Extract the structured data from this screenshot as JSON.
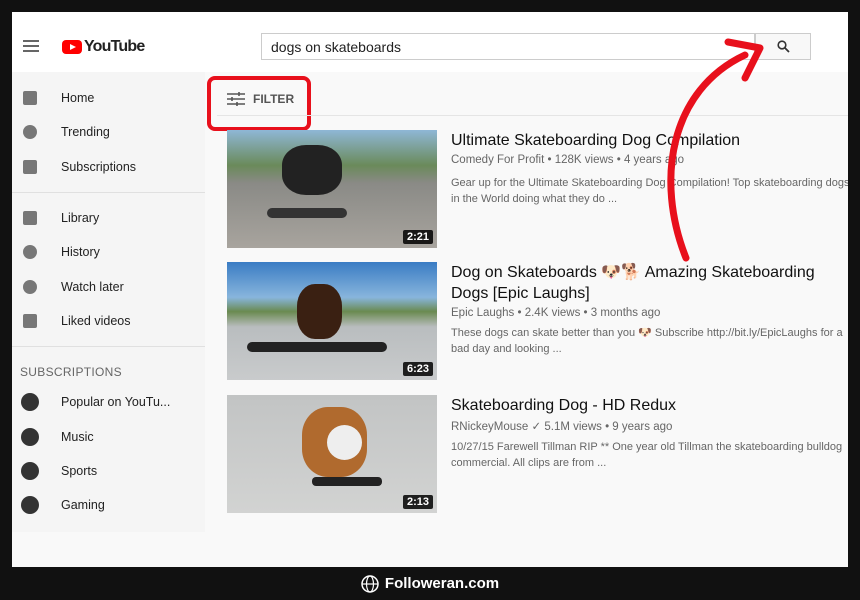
{
  "header": {
    "logo_text": "YouTube",
    "search_value": "dogs on skateboards"
  },
  "sidebar": {
    "items": [
      {
        "label": "Home",
        "icon": "home-icon"
      },
      {
        "label": "Trending",
        "icon": "fire-icon"
      },
      {
        "label": "Subscriptions",
        "icon": "subscriptions-icon"
      }
    ],
    "items2": [
      {
        "label": "Library",
        "icon": "folder-icon"
      },
      {
        "label": "History",
        "icon": "history-icon"
      },
      {
        "label": "Watch later",
        "icon": "clock-icon"
      },
      {
        "label": "Liked videos",
        "icon": "thumbs-up-icon"
      }
    ],
    "subscriptions_heading": "SUBSCRIPTIONS",
    "subscriptions": [
      {
        "label": "Popular on YouTu..."
      },
      {
        "label": "Music"
      },
      {
        "label": "Sports"
      },
      {
        "label": "Gaming"
      }
    ]
  },
  "filter_label": "FILTER",
  "videos": [
    {
      "title": "Ultimate Skateboarding Dog Compilation",
      "channel": "Comedy For Profit",
      "meta": " • 128K views • 4 years ago",
      "description": "Gear up for the Ultimate Skateboarding Dog Compilation! Top skateboarding dogs in the World doing what they do ...",
      "duration": "2:21"
    },
    {
      "title": "Dog on Skateboards 🐶🐕 Amazing Skateboarding Dogs [Epic Laughs]",
      "channel": "Epic Laughs",
      "meta": " • 2.4K views • 3 months ago",
      "description": "These dogs can skate better than you 🐶 Subscribe http://bit.ly/EpicLaughs for a bad day and looking ...",
      "duration": "6:23"
    },
    {
      "title": "Skateboarding Dog - HD Redux",
      "channel": "RNickeyMouse ✓",
      "meta": " 5.1M views • 9 years ago",
      "description": "10/27/15 Farewell Tillman RIP ** One year old Tillman the skateboarding bulldog commercial. All clips are from ...",
      "duration": "2:13"
    }
  ],
  "watermark": "Followeran.com",
  "colors": {
    "annotation_red": "#e8101c",
    "youtube_red": "#ff0000"
  }
}
